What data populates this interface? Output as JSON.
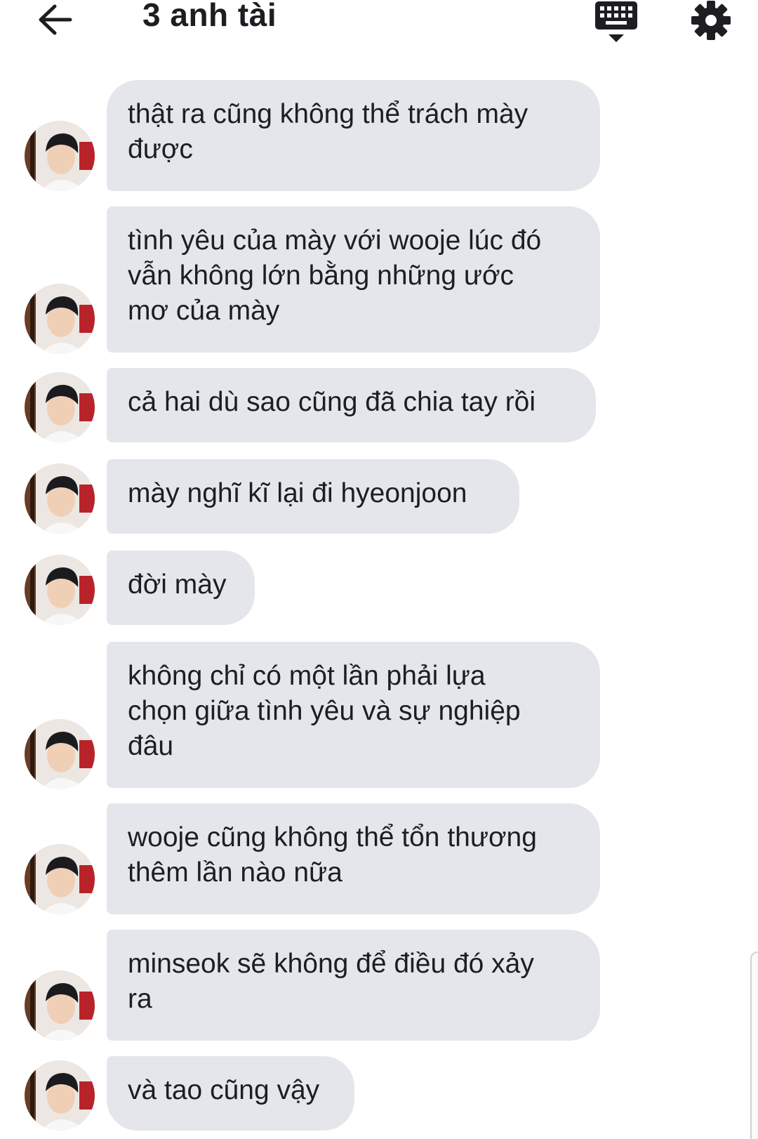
{
  "header": {
    "title": "3 anh tài",
    "back_icon": "arrow-left-icon",
    "keyboard_icon": "keyboard-icon",
    "settings_icon": "gear-icon"
  },
  "colors": {
    "bubble_bg": "#e4e6eb",
    "text": "#1c1e21",
    "background": "#ffffff"
  },
  "messages": [
    {
      "text": "thật ra cũng không thể trách mày\nđược"
    },
    {
      "text": "tình yêu của mày với wooje lúc đó\nvẫn không lớn bằng những ước\nmơ của mày"
    },
    {
      "text": "cả hai dù sao cũng đã chia tay rồi"
    },
    {
      "text": "mày nghĩ kĩ lại đi hyeonjoon"
    },
    {
      "text": "đời mày"
    },
    {
      "text": "không chỉ có một lần phải lựa\nchọn giữa tình yêu và sự nghiệp\nđâu"
    },
    {
      "text": "wooje cũng không thể tổn thương\nthêm lần nào nữa"
    },
    {
      "text": "minseok sẽ không để điều đó xảy\nra"
    },
    {
      "text": "và tao cũng vậy"
    }
  ]
}
